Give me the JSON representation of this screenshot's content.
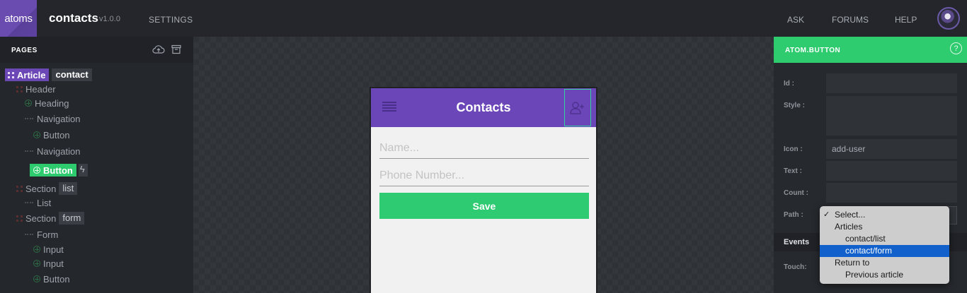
{
  "topbar": {
    "logo_text": "atoms",
    "app_name": "contacts",
    "version": "v1.0.0",
    "nav": {
      "settings": "SETTINGS",
      "ask": "ASK",
      "forums": "FORUMS",
      "help": "HELP"
    }
  },
  "sidebar": {
    "title": "PAGES",
    "tree": {
      "article": {
        "label": "Article",
        "tag": "contact"
      },
      "header": "Header",
      "heading": "Heading",
      "navigation1": "Navigation",
      "button1": "Button",
      "navigation2": "Navigation",
      "button_selected": "Button",
      "section1": {
        "label": "Section",
        "tag": "list"
      },
      "list": "List",
      "section2": {
        "label": "Section",
        "tag": "form"
      },
      "form": "Form",
      "input1": "Input",
      "input2": "Input",
      "button3": "Button"
    }
  },
  "preview": {
    "title": "Contacts",
    "name_placeholder": "Name...",
    "phone_placeholder": "Phone Number...",
    "save_label": "Save"
  },
  "inspector": {
    "title": "ATOM.BUTTON",
    "help_glyph": "?",
    "labels": {
      "id": "Id :",
      "style": "Style :",
      "icon": "Icon :",
      "text": "Text :",
      "count": "Count :",
      "path": "Path :",
      "touch": "Touch:"
    },
    "values": {
      "id": "",
      "style": "",
      "icon": "add-user",
      "text": "",
      "count": ""
    },
    "events_title": "Events"
  },
  "path_dropdown": {
    "check": "✓",
    "options": [
      {
        "label": "Select...",
        "checked": true
      },
      {
        "label": "Articles"
      },
      {
        "label": "contact/list"
      },
      {
        "label": "contact/form",
        "highlighted": true
      },
      {
        "label": "Return to"
      },
      {
        "label": "Previous article"
      }
    ]
  },
  "colors": {
    "purple": "#6b46b8",
    "green": "#2ecb6f",
    "dark_bg": "#24262b",
    "highlight_blue": "#1160cc"
  }
}
